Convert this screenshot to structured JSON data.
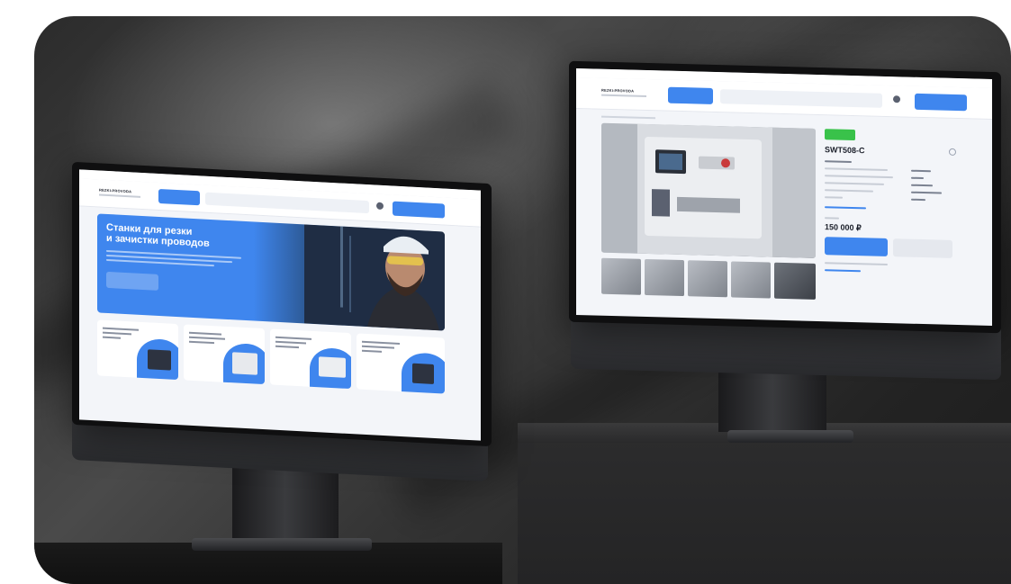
{
  "left_screen": {
    "logo": "REZKI-PROVODA",
    "catalog_button": "",
    "search_placeholder": "",
    "cta_button": "",
    "hero_title_line1": "Станки для резки",
    "hero_title_line2": "и зачистки проводов",
    "hero_button": "",
    "categories": [
      {
        "label": ""
      },
      {
        "label": ""
      },
      {
        "label": ""
      },
      {
        "label": ""
      }
    ]
  },
  "right_screen": {
    "logo": "REZKI-PROVODA",
    "catalog_button": "",
    "search_placeholder": "",
    "cta_button": "",
    "badge": "",
    "product_title": "SWT508-C",
    "price": "150 000 ₽",
    "buy_button": "",
    "secondary_button": ""
  },
  "colors": {
    "accent": "#3f86ee",
    "badge_green": "#39c24a",
    "screen_bg": "#f3f5f9",
    "backdrop": "#2b2b2b"
  }
}
